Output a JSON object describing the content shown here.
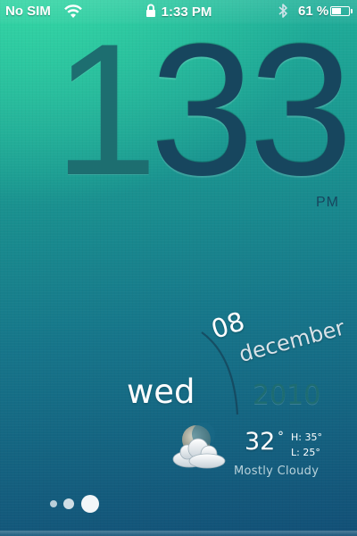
{
  "status_bar": {
    "carrier": "No SIM",
    "wifi_icon": "wifi-icon",
    "lock_icon": "lock-icon",
    "time": "1:33 PM",
    "bluetooth_icon": "bluetooth-icon",
    "battery_percent_label": "61 %",
    "battery_level": 0.61
  },
  "clock": {
    "hour": "1",
    "minutes": "33",
    "ampm": "PM"
  },
  "date": {
    "day": "08",
    "month": "december",
    "weekday": "wed",
    "year": "2010"
  },
  "weather": {
    "icon": "partly-cloudy-night-icon",
    "temperature": "32",
    "degree_symbol": "°",
    "high": "H: 35°",
    "low": "L: 25°",
    "condition": "Mostly Cloudy"
  },
  "pagination": {
    "dot_count": 3,
    "active_index": 2
  },
  "colors": {
    "background_top": "#35d9a5",
    "background_bottom": "#124f76",
    "hour_digit": "#1d6e70",
    "minute_digits": "#17465e",
    "year": "#1d6c72"
  }
}
